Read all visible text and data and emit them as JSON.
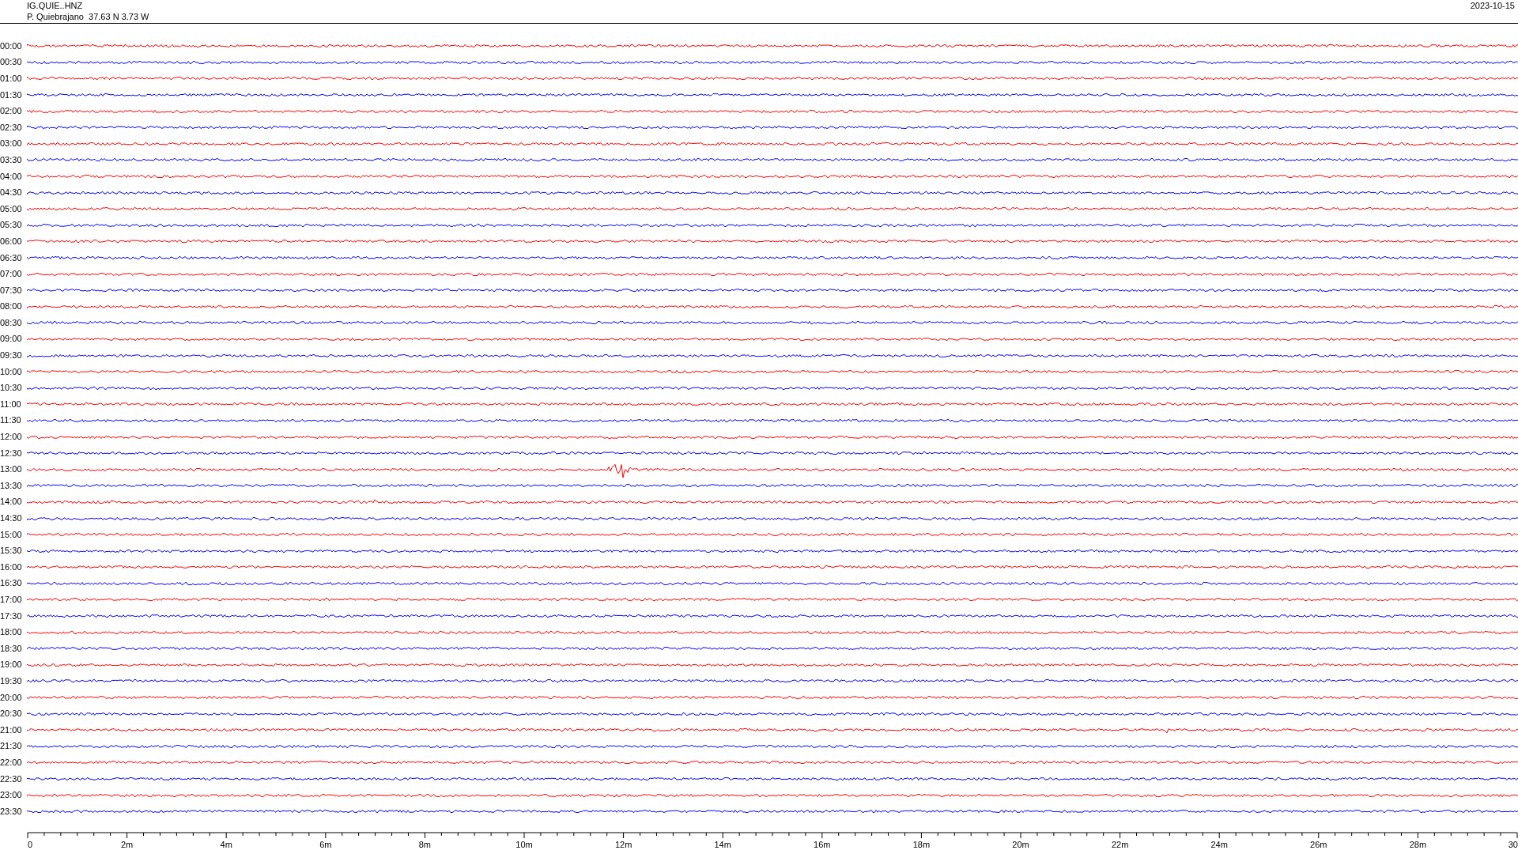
{
  "header": {
    "station": "IG.QUIE..HNZ",
    "location": "P. Quiebrajano  37.63 N 3.73 W",
    "date": "2023-10-15"
  },
  "rows": [
    {
      "time": "00:00",
      "color": "#ff0000"
    },
    {
      "time": "00:30",
      "color": "#0000ff"
    },
    {
      "time": "01:00",
      "color": "#ff0000"
    },
    {
      "time": "01:30",
      "color": "#0000ff"
    },
    {
      "time": "02:00",
      "color": "#ff0000"
    },
    {
      "time": "02:30",
      "color": "#0000ff"
    },
    {
      "time": "03:00",
      "color": "#ff0000"
    },
    {
      "time": "03:30",
      "color": "#0000ff"
    },
    {
      "time": "04:00",
      "color": "#ff0000"
    },
    {
      "time": "04:30",
      "color": "#0000ff"
    },
    {
      "time": "05:00",
      "color": "#ff0000"
    },
    {
      "time": "05:30",
      "color": "#0000ff"
    },
    {
      "time": "06:00",
      "color": "#ff0000"
    },
    {
      "time": "06:30",
      "color": "#0000ff"
    },
    {
      "time": "07:00",
      "color": "#ff0000"
    },
    {
      "time": "07:30",
      "color": "#0000ff"
    },
    {
      "time": "08:00",
      "color": "#ff0000"
    },
    {
      "time": "08:30",
      "color": "#0000ff"
    },
    {
      "time": "09:00",
      "color": "#ff0000"
    },
    {
      "time": "09:30",
      "color": "#0000ff"
    },
    {
      "time": "10:00",
      "color": "#ff0000"
    },
    {
      "time": "10:30",
      "color": "#0000ff"
    },
    {
      "time": "11:00",
      "color": "#ff0000"
    },
    {
      "time": "11:30",
      "color": "#0000ff"
    },
    {
      "time": "12:00",
      "color": "#ff0000"
    },
    {
      "time": "12:30",
      "color": "#0000ff"
    },
    {
      "time": "13:00",
      "color": "#ff0000"
    },
    {
      "time": "13:30",
      "color": "#0000ff"
    },
    {
      "time": "14:00",
      "color": "#ff0000"
    },
    {
      "time": "14:30",
      "color": "#0000ff"
    },
    {
      "time": "15:00",
      "color": "#ff0000"
    },
    {
      "time": "15:30",
      "color": "#0000ff"
    },
    {
      "time": "16:00",
      "color": "#ff0000"
    },
    {
      "time": "16:30",
      "color": "#0000ff"
    },
    {
      "time": "17:00",
      "color": "#ff0000"
    },
    {
      "time": "17:30",
      "color": "#0000ff"
    },
    {
      "time": "18:00",
      "color": "#ff0000"
    },
    {
      "time": "18:30",
      "color": "#0000ff"
    },
    {
      "time": "19:00",
      "color": "#ff0000"
    },
    {
      "time": "19:30",
      "color": "#0000ff"
    },
    {
      "time": "20:00",
      "color": "#ff0000"
    },
    {
      "time": "20:30",
      "color": "#0000ff"
    },
    {
      "time": "21:00",
      "color": "#ff0000"
    },
    {
      "time": "21:30",
      "color": "#0000ff"
    },
    {
      "time": "22:00",
      "color": "#ff0000"
    },
    {
      "time": "22:30",
      "color": "#0000ff"
    },
    {
      "time": "23:00",
      "color": "#ff0000"
    },
    {
      "time": "23:30",
      "color": "#0000ff"
    }
  ],
  "axis": {
    "ticks": [
      "0",
      "2m",
      "4m",
      "6m",
      "8m",
      "10m",
      "12m",
      "14m",
      "16m",
      "18m",
      "20m",
      "22m",
      "24m",
      "26m",
      "28m",
      "30"
    ]
  }
}
